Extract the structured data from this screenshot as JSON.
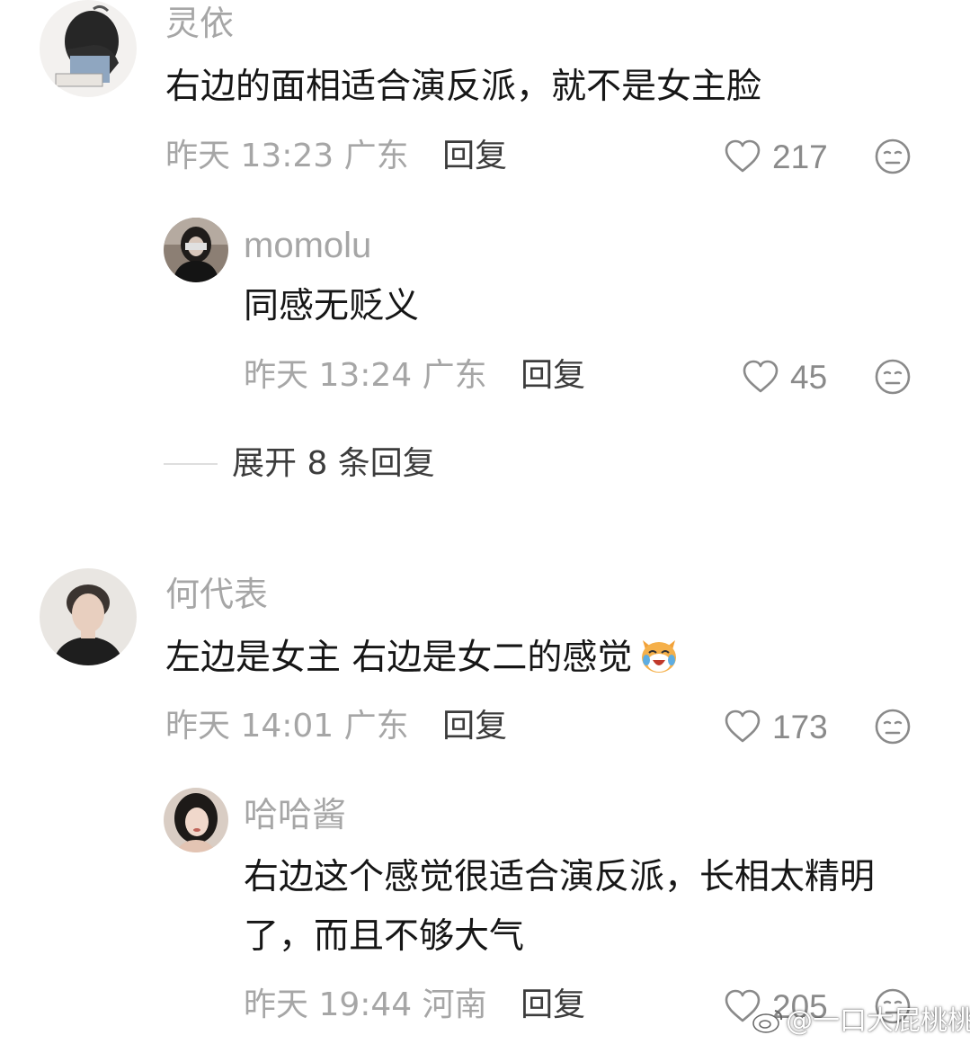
{
  "reply_label": "回复",
  "comments": [
    {
      "username": "灵依",
      "text_lines": [
        "右边的面相适合演反派，就不是女主脸"
      ],
      "time": "昨天 13:23",
      "location": "广东",
      "likes": "217",
      "replies": [
        {
          "username": "momolu",
          "text_lines": [
            "同感无贬义"
          ],
          "time": "昨天 13:24",
          "location": "广东",
          "likes": "45"
        }
      ],
      "expand_label": "展开 8 条回复"
    },
    {
      "username": "何代表",
      "text_lines": [
        "左边是女主 右边是女二的感觉"
      ],
      "emoji": "laughing-cat-emoji",
      "time": "昨天 14:01",
      "location": "广东",
      "likes": "173",
      "replies": [
        {
          "username": "哈哈酱",
          "text_lines": [
            "右边这个感觉很适合演反派，长相太精明",
            "了，而且不够大气"
          ],
          "time": "昨天 19:44",
          "location": "河南",
          "likes": "205"
        }
      ]
    }
  ],
  "watermark": "@一口大屁桃桃",
  "icons": {
    "like": "heart-outline-icon",
    "dislike": "meh-face-icon"
  },
  "colors": {
    "username": "#a6a6a6",
    "text": "#161616",
    "meta": "#a6a6a6",
    "reply": "#3c3c3c",
    "icon": "#8a8a8a"
  }
}
